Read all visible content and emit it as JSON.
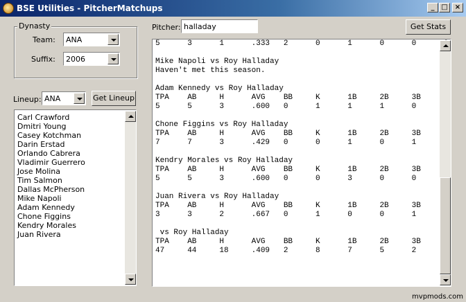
{
  "window": {
    "title": "BSE Utilities - PitcherMatchups"
  },
  "dynasty": {
    "group_label": "Dynasty",
    "team_label": "Team:",
    "team_value": "ANA",
    "suffix_label": "Suffix:",
    "suffix_value": "2006"
  },
  "lineup": {
    "label": "Lineup:",
    "value": "ANA",
    "button": "Get Lineup",
    "players": [
      "Carl Crawford",
      "Dmitri Young",
      "Casey Kotchman",
      "Darin Erstad",
      "Orlando Cabrera",
      "Vladimir Guerrero",
      "Jose Molina",
      "Tim Salmon",
      "Dallas McPherson",
      "Mike Napoli",
      "Adam Kennedy",
      "Chone Figgins",
      "Kendry Morales",
      "Juan Rivera"
    ]
  },
  "pitcher": {
    "label": "Pitcher:",
    "value": "halladay",
    "button": "Get Stats"
  },
  "output": {
    "text": "5      3      1      .333   2      0      1      0      0      0\n\nMike Napoli vs Roy Halladay\nHaven't met this season.\n\nAdam Kennedy vs Roy Halladay\nTPA    AB     H      AVG    BB     K      1B     2B     3B     HR\n5      5      3      .600   0      1      1      1      0      1\n\nChone Figgins vs Roy Halladay\nTPA    AB     H      AVG    BB     K      1B     2B     3B     HR\n7      7      3      .429   0      0      1      0      1      1\n\nKendry Morales vs Roy Halladay\nTPA    AB     H      AVG    BB     K      1B     2B     3B     HR\n5      5      3      .600   0      0      3      0      0      0\n\nJuan Rivera vs Roy Halladay\nTPA    AB     H      AVG    BB     K      1B     2B     3B     HR\n3      3      2      .667   0      1      0      0      1      1\n\n vs Roy Halladay\nTPA    AB     H      AVG    BB     K      1B     2B     3B     HR\n47     44     18     .409   2      8      7      5      2      4"
  },
  "watermark": "mvpmods.com"
}
